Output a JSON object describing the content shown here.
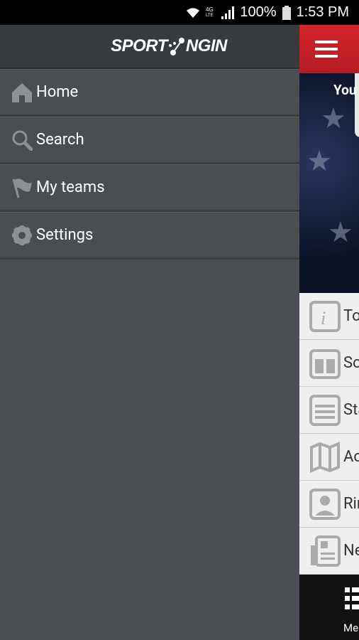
{
  "status_bar": {
    "battery": "100%",
    "time": "1:53 PM",
    "network": "4G LTE",
    "icons": [
      "wifi-icon",
      "network-4g-icon",
      "signal-icon",
      "battery-icon"
    ]
  },
  "drawer": {
    "logo": "SPORTNGIN",
    "items": [
      {
        "label": "Home",
        "icon": "home-icon"
      },
      {
        "label": "Search",
        "icon": "search-icon"
      },
      {
        "label": "My teams",
        "icon": "flag-icon"
      },
      {
        "label": "Settings",
        "icon": "gear-icon"
      }
    ]
  },
  "main": {
    "banner_text": "You",
    "menu": [
      {
        "label": "To",
        "icon": "info-icon"
      },
      {
        "label": "Sc",
        "icon": "calendar-icon"
      },
      {
        "label": "Sta",
        "icon": "list-icon"
      },
      {
        "label": "Ac",
        "icon": "map-icon"
      },
      {
        "label": "Rin",
        "icon": "location-icon"
      },
      {
        "label": "Ne",
        "icon": "newspaper-icon"
      }
    ],
    "bottom_label": "Me"
  },
  "colors": {
    "accent": "#d4242b",
    "drawer_bg": "#4a4e52",
    "drawer_header": "#363b3e"
  }
}
